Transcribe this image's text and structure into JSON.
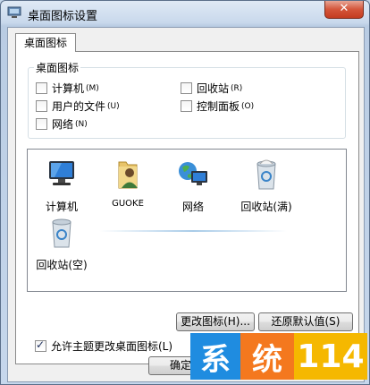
{
  "window": {
    "title": "桌面图标设置",
    "close_label": "✕"
  },
  "tab": {
    "label": "桌面图标"
  },
  "group": {
    "title": "桌面图标",
    "checkboxes": [
      {
        "label": "计算机",
        "key": "(M)",
        "checked": false
      },
      {
        "label": "回收站",
        "key": "(R)",
        "checked": false
      },
      {
        "label": "用户的文件",
        "key": "(U)",
        "checked": false
      },
      {
        "label": "控制面板",
        "key": "(O)",
        "checked": false
      },
      {
        "label": "网络",
        "key": "(N)",
        "checked": false
      }
    ]
  },
  "icons": [
    {
      "label": "计算机",
      "icon": "computer-icon"
    },
    {
      "label": "GUOKE",
      "icon": "user-folder-icon"
    },
    {
      "label": "网络",
      "icon": "network-icon"
    },
    {
      "label": "回收站(满)",
      "icon": "recycle-bin-full-icon"
    },
    {
      "label": "回收站(空)",
      "icon": "recycle-bin-empty-icon"
    }
  ],
  "buttons": {
    "change_icon": "更改图标(H)...",
    "restore_default": "还原默认值(S)",
    "ok": "确定"
  },
  "allow_themes": {
    "label": "允许主题更改桌面图标(L)",
    "checked": true
  },
  "watermark": {
    "chars": [
      "系",
      "统",
      "114"
    ],
    "colors": [
      "#1f8ce0",
      "#f4781e",
      "#f5b800"
    ]
  }
}
